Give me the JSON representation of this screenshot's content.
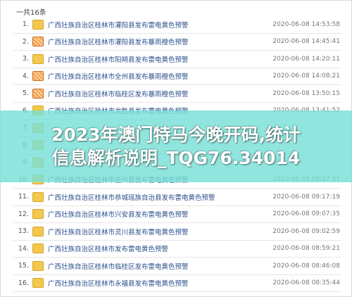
{
  "header": {
    "total_label": "一共16条"
  },
  "rows": [
    {
      "num": "1.",
      "icon": "yellow-warning-icon",
      "title": "广西壮族自治区桂林市灌阳县发布雷电黄色预警",
      "time": "2020-06-08 14:53:58"
    },
    {
      "num": "2.",
      "icon": "orange-rain-warning-icon",
      "title": "广西壮族自治区桂林市灌阳县发布暴雨橙色预警",
      "time": "2020-06-08 14:45:41"
    },
    {
      "num": "3.",
      "icon": "yellow-warning-icon",
      "title": "广西壮族自治区桂林市阳朔县发布雷电黄色预警",
      "time": "2020-06-08 14:20:11"
    },
    {
      "num": "4.",
      "icon": "orange-rain-warning-icon",
      "title": "广西壮族自治区桂林市全州县发布暴雨橙色预警",
      "time": "2020-06-08 14:08:21"
    },
    {
      "num": "5.",
      "icon": "orange-rain-warning-icon",
      "title": "广西壮族自治区桂林市临桂区发布暴雨橙色预警",
      "time": "2020-06-08 13:50:15"
    },
    {
      "num": "6.",
      "icon": "yellow-warning-icon",
      "title": "广西壮族自治区桂林市龙胜县发布雷电黄色预警",
      "time": "2020-06-08 13:41:52"
    },
    {
      "num": "7.",
      "icon": "yellow-warning-icon",
      "title": "",
      "time": ""
    },
    {
      "num": "8.",
      "icon": "yellow-warning-icon",
      "title": "",
      "time": ""
    },
    {
      "num": "9.",
      "icon": "yellow-warning-icon",
      "title": "",
      "time": ""
    },
    {
      "num": "10.",
      "icon": "yellow-warning-icon",
      "title": "广西壮族自治区桂林市全州县发布雷电黄色预警",
      "time": "2020-06-08 09:27:01"
    },
    {
      "num": "11.",
      "icon": "yellow-warning-icon",
      "title": "广西壮族自治区桂林市恭城瑶族自治县发布雷电黄色预警",
      "time": "2020-06-08 09:17:19"
    },
    {
      "num": "12.",
      "icon": "yellow-warning-icon",
      "title": "广西壮族自治区桂林市兴安县发布雷电黄色预警",
      "time": "2020-06-08 09:07:35"
    },
    {
      "num": "13.",
      "icon": "yellow-warning-icon",
      "title": "广西壮族自治区桂林市灵川县发布雷电黄色预警",
      "time": "2020-06-08 09:02:59"
    },
    {
      "num": "14.",
      "icon": "yellow-warning-icon",
      "title": "广西壮族自治区桂林市发布雷电黄色预警",
      "time": "2020-06-08 08:59:21"
    },
    {
      "num": "15.",
      "icon": "yellow-warning-icon",
      "title": "广西壮族自治区桂林市临桂区发布雷电黄色预警",
      "time": "2020-06-08 08:46:08"
    },
    {
      "num": "16.",
      "icon": "yellow-warning-icon",
      "title": "广西壮族自治区桂林市永福县发布雷电黄色预警",
      "time": "2020-06-08 08:35:44"
    }
  ],
  "banner": {
    "line1": "2023年澳门特马今晚开码,统计",
    "line2": "信息解析说明_TQG76.34014",
    "color": "#78e1d7"
  }
}
